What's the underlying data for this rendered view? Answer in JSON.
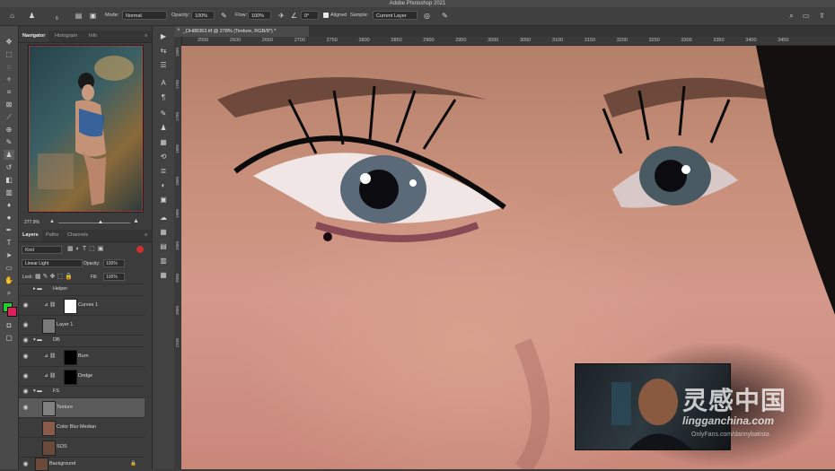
{
  "app": {
    "title": "Adobe Photoshop 2021"
  },
  "options_bar": {
    "mode_label": "Mode:",
    "mode_value": "Normal",
    "opacity_label": "Opacity:",
    "opacity_value": "100%",
    "flow_label": "Flow:",
    "flow_value": "100%",
    "angle_value": "0°",
    "aligned_label": "Aligned",
    "sample_label": "Sample:",
    "sample_value": "Current Layer",
    "brush_size": "6"
  },
  "navigator": {
    "tabs": [
      "Navigator",
      "Histogram",
      "Info"
    ],
    "zoom": "277.9%"
  },
  "layers_panel": {
    "tabs": [
      "Layers",
      "Paths",
      "Channels"
    ],
    "filter_value": "Kind",
    "blend_mode": "Linear Light",
    "opacity_label": "Opacity:",
    "opacity_value": "100%",
    "lock_label": "Lock:",
    "fill_label": "Fill:",
    "fill_value": "100%",
    "layers": [
      {
        "name": "Helper",
        "type": "group"
      },
      {
        "name": "Curves 1",
        "type": "adjustment"
      },
      {
        "name": "Layer 1",
        "type": "pixel"
      },
      {
        "name": "DB",
        "type": "group"
      },
      {
        "name": "Burn",
        "type": "adjustment"
      },
      {
        "name": "Dodge",
        "type": "adjustment"
      },
      {
        "name": "FS",
        "type": "group"
      },
      {
        "name": "Texture",
        "type": "pixel",
        "selected": true
      },
      {
        "name": "Color Blur Median",
        "type": "pixel"
      },
      {
        "name": "SOS",
        "type": "pixel"
      },
      {
        "name": "Background",
        "type": "pixel",
        "locked": true
      }
    ]
  },
  "document": {
    "tab_title": "_DH88363.tif @ 278% (Texture, RGB/8*) *",
    "ruler_h": [
      "2550",
      "2600",
      "2650",
      "2700",
      "2750",
      "2800",
      "2850",
      "2900",
      "2950",
      "3000",
      "3050",
      "3100",
      "3150",
      "3200",
      "3250",
      "3300",
      "3350",
      "3400",
      "3450"
    ],
    "ruler_v": [
      "1650",
      "1700",
      "1750",
      "1800",
      "1850",
      "1900",
      "1950",
      "2000",
      "2050",
      "2100"
    ]
  },
  "watermark": {
    "main": "灵感中国",
    "sub": "lingganchina.com",
    "credit": "OnlyFans.com/dannybatista"
  },
  "colors": {
    "foreground": "#22cc33",
    "background": "#e0205a"
  }
}
